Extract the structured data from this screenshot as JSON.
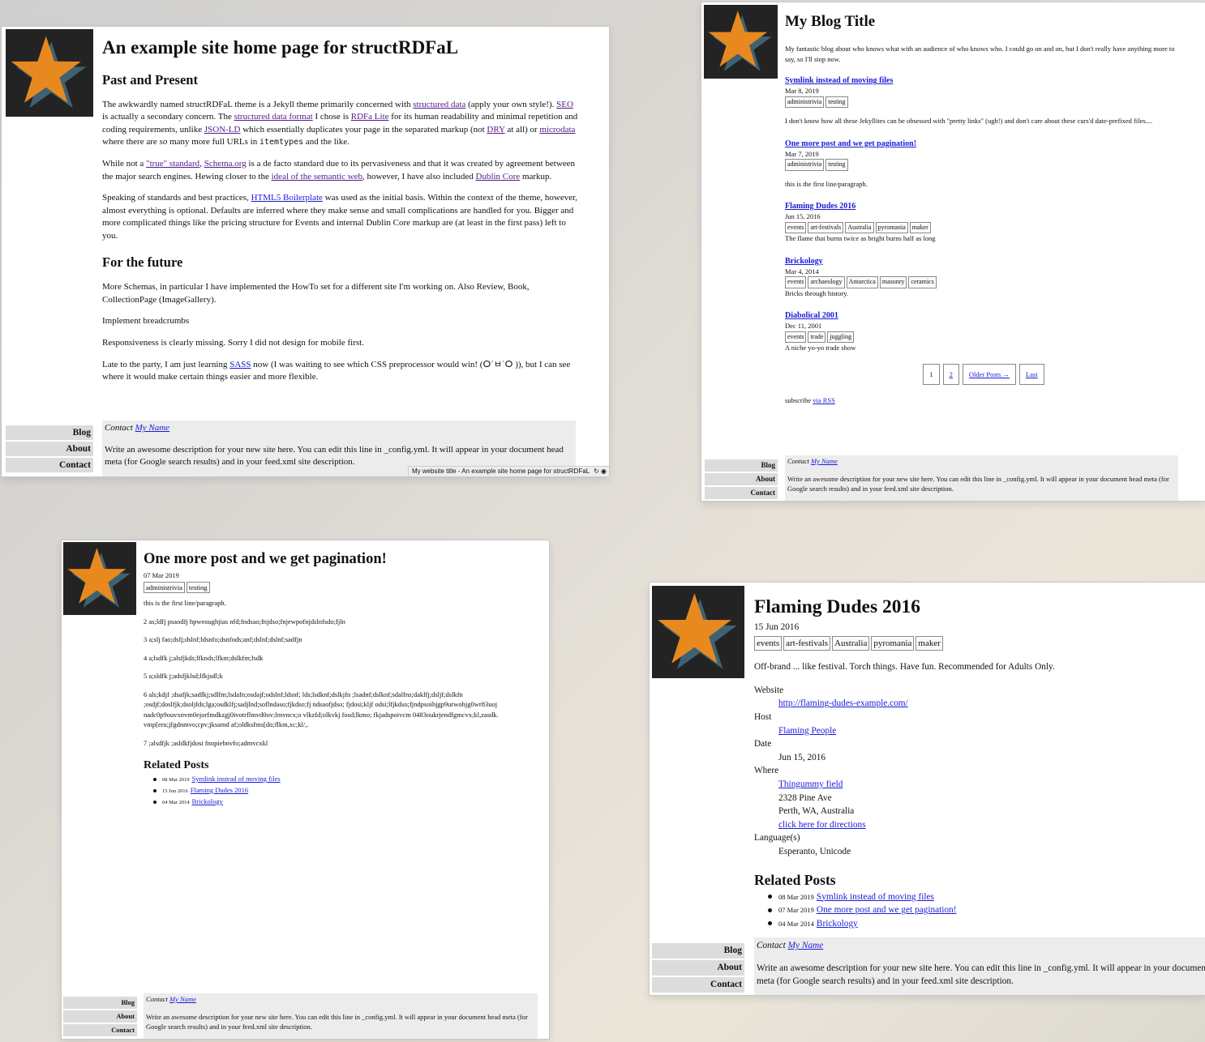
{
  "win1": {
    "title": "An example site home page for structRDFaL",
    "h_past": "Past and Present",
    "p1": [
      {
        "t": "The awkwardly named structRDFaL theme is a Jekyll theme primarily concerned with "
      },
      {
        "t": "structured data",
        "link": "v"
      },
      {
        "t": " (apply your own style!). "
      },
      {
        "t": "SEO",
        "link": "v"
      },
      {
        "t": " is actually a secondary concern. The "
      },
      {
        "t": "structured data format",
        "link": "v"
      },
      {
        "t": " I chose is "
      },
      {
        "t": "RDFa Lite",
        "link": "v"
      },
      {
        "t": " for its human readability and minimal repetition and coding requirements, unlike "
      },
      {
        "t": "JSON-LD",
        "link": "v"
      },
      {
        "t": " which essentially duplicates your page in the separated markup (not "
      },
      {
        "t": "DRY",
        "link": "v"
      },
      {
        "t": " at all) or "
      },
      {
        "t": "microdata",
        "link": "v"
      },
      {
        "t": " where there are "
      },
      {
        "t": "so",
        "em": true
      },
      {
        "t": " many more full URLs in "
      },
      {
        "t": "itemtypes",
        "code": true
      },
      {
        "t": " and the like."
      }
    ],
    "p2": [
      {
        "t": "While not a "
      },
      {
        "t": "\"true\" standard",
        "link": "v"
      },
      {
        "t": ", "
      },
      {
        "t": "Schema.org",
        "link": "v"
      },
      {
        "t": " is a de facto standard due to its pervasiveness and that it was created by agreement between the major search engines. Hewing closer to the "
      },
      {
        "t": "ideal of the semantic web",
        "link": "v"
      },
      {
        "t": ", however, I have also included "
      },
      {
        "t": "Dublin Core",
        "link": "v"
      },
      {
        "t": " markup."
      }
    ],
    "p3": [
      {
        "t": "Speaking of standards and best practices, "
      },
      {
        "t": "HTML5 Boilerplate",
        "link": "b"
      },
      {
        "t": " was used as the initial basis. Within the context of the theme, however, almost everything is optional. Defaults are inferred where they make sense and small complications are handled for you. Bigger and more complicated things like the pricing structure for Events and internal Dublin Core markup are (at least in the first pass) left to you."
      }
    ],
    "h_future": "For the future",
    "p4": "More Schemas, in particular I have implemented the HowTo set for a different site I'm working on. Also Review, Book, CollectionPage (ImageGallery).",
    "p5": "Implement breadcrumbs",
    "p6": "Responsiveness is clearly missing. Sorry I did not design for mobile first.",
    "p7": [
      {
        "t": "Late to the party, I am just learning "
      },
      {
        "t": "SASS",
        "link": "b"
      },
      {
        "t": " now (I was waiting to see which CSS preprocessor would win! (ⵔ´ㅂ`ⵔ )), but I can see where it would make certain things easier and more flexible."
      }
    ],
    "status": "My website title - An example site home page for structRDFaL"
  },
  "win2": {
    "title": "My Blog Title",
    "desc": "My fantastic blog about who knows what with an audience of who knows who. I could go on and on, but I don't really have anything more to say, so I'll stop now.",
    "posts": [
      {
        "title": "Symlink instead of moving files",
        "date": "Mar 8, 2019",
        "tags": [
          "administrivia",
          "testing"
        ],
        "excerpt": "I don't know how all these Jekyllites can be obsessed with \"pretty links\" (ugh!) and don't care about these curs'd date-prefixed files...."
      },
      {
        "title": "One more post and we get pagination!",
        "date": "Mar 7, 2019",
        "tags": [
          "administrivia",
          "testing"
        ],
        "excerpt": "this is the first line/paragraph."
      },
      {
        "title": "Flaming Dudes 2016",
        "date": "Jun 15, 2016",
        "tags": [
          "events",
          "art-festivals",
          "Australia",
          "pyromania",
          "maker"
        ],
        "excerpt": "The flame that burns twice as bright burns half as long"
      },
      {
        "title": "Brickology",
        "date": "Mar 4, 2014",
        "tags": [
          "events",
          "archaeology",
          "Antarctica",
          "masonry",
          "ceramics"
        ],
        "excerpt": "Bricks through history."
      },
      {
        "title": "Diabolical 2001",
        "date": "Dec 11, 2001",
        "tags": [
          "events",
          "trade",
          "juggling"
        ],
        "excerpt": "A niche yo-yo trade show"
      }
    ],
    "pager": [
      "1",
      "2",
      "Older Posts →",
      "Last"
    ],
    "subscribe": "subscribe ",
    "rss": "via RSS"
  },
  "win3": {
    "title": "One more post and we get pagination!",
    "date": "07 Mar 2019",
    "tags": [
      "administrivia",
      "testing"
    ],
    "lines": [
      "this is the first line/paragraph.",
      "2 as;ldfj psaodfj hpweoughjias nfd;fndsao;fnjdso;fnjewpofnjdslnfsdo;fjln",
      "3 a;slj fao;dsfj;dslnf;ldsnfo;dsnfods;anf;dslnf;dslnf;sadfjn",
      "4 a;lsdfk j;alsfjkds;lfknds;lfkm;dslkfm;lsdk",
      "5 a;sldfk j;adsfjklsd;lfkjsdl;k",
      "6 als;kdjf ;dsafjk;sadfkj;sdlfm;lsdafn;osdajf;odslnf;ldsnf; lds;lsdknf;dslkjfn ;lsadnf;dslknf;sdalfns;daklfj;dsljf;dslkfn ;osdjf;doslfjk;dsoljfds;lga;osdklfj;sadjlnd;soflndaso;fjkdso;fj ndsaofjdso; fjdosi;kljf odsi;lfjkdso;fjndpsoihjgp9urwohjg0wr83uoj nadc0p9ouvxnvm0ejorfmdkzgj0ivotrflmvd0ov;lmvncx;o vlkzfd;olkvkj fosd;lkmo; fkjadspoivcm 0483oukrjendfgmcvx;kl,zasdk. vmp[eru;jfgdnmvo;cpv;jksamd af;oldksfms[do;flkm,xc;kl/,.",
      "7 ;alsdfjk ;asldkfjdosi fnopiebnvfo;admvcxkl"
    ],
    "related_h": "Related Posts",
    "related": [
      {
        "date": "08 Mar 2019",
        "title": "Symlink instead of moving files"
      },
      {
        "date": "15 Jun 2016",
        "title": "Flaming Dudes 2016"
      },
      {
        "date": "04 Mar 2014",
        "title": "Brickology"
      }
    ]
  },
  "win4": {
    "title": "Flaming Dudes 2016",
    "date": "15 Jun 2016",
    "tags": [
      "events",
      "art-festivals",
      "Australia",
      "pyromania",
      "maker"
    ],
    "intro": "Off-brand ... like festival. Torch things. Have fun. Recommended for Adults Only.",
    "website_label": "Website",
    "website": "http://flaming-dudes-example.com/",
    "host_label": "Host",
    "host": "Flaming People",
    "date_label": "Date",
    "date_value": "Jun 15, 2016",
    "where_label": "Where",
    "place": "Thingummy field",
    "street": "2328 Pine Ave",
    "city": "Perth, WA, Australia",
    "directions": "click here for directions",
    "lang_label": "Language(s)",
    "langs": "Esperanto, Unicode",
    "related_h": "Related Posts",
    "related": [
      {
        "date": "08 Mar 2019",
        "title": "Symlink instead of moving files"
      },
      {
        "date": "07 Mar 2019",
        "title": "One more post and we get pagination!"
      },
      {
        "date": "04 Mar 2014",
        "title": "Brickology"
      }
    ]
  },
  "common": {
    "nav": [
      "Blog",
      "About",
      "Contact"
    ],
    "contact_prefix": "Contact ",
    "contact_name": "My Name",
    "site_desc": "Write an awesome description for your new site here. You can edit this line in _config.yml. It will appear in your document head meta (for Google search results) and in your feed.xml site description."
  },
  "colors": {
    "star": "#e8891f",
    "star_shadow": "#3f6272",
    "logo_bg": "#232323"
  }
}
